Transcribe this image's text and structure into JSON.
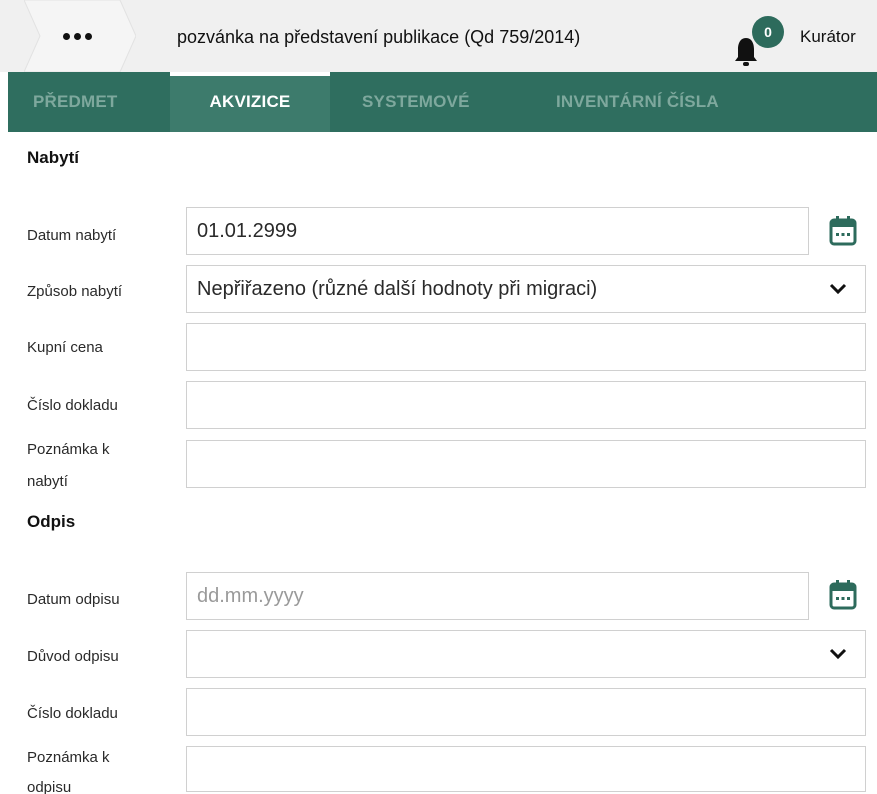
{
  "header": {
    "more_label": "•••",
    "title": "pozvánka na představení publikace (Qd 759/2014)",
    "notification_count": "0",
    "user": "Kurátor"
  },
  "tabs": [
    {
      "label": "PŘEDMET",
      "active": false
    },
    {
      "label": "AKVIZICE",
      "active": true
    },
    {
      "label": "SYSTEMOVÉ",
      "active": false
    },
    {
      "label": "INVENTÁRNÍ ČÍSLA",
      "active": false
    }
  ],
  "acquisition": {
    "title": "Nabytí",
    "date_label": "Datum nabytí",
    "date_value": "01.01.2999",
    "method_label": "Způsob nabytí",
    "method_value": "Nepřiřazeno (různé další hodnoty při migraci)",
    "price_label": "Kupní cena",
    "price_value": "",
    "doc_number_label": "Číslo dokladu",
    "doc_number_value": "",
    "note_label_1": "Poznámka k",
    "note_label_2": "nabytí",
    "note_value": ""
  },
  "writeoff": {
    "title": "Odpis",
    "date_label": "Datum odpisu",
    "date_placeholder": "dd.mm.yyyy",
    "reason_label": "Důvod odpisu",
    "reason_value": "",
    "doc_number_label": "Číslo dokladu",
    "doc_number_value": "",
    "note_label_1": "Poznámka k",
    "note_label_2": "odpisu",
    "note_value": ""
  },
  "colors": {
    "tab_bar": "#2f6e5f",
    "tab_active": "#3d7b6c",
    "badge": "#2d6b5c",
    "calendar_icon": "#2d6b5c"
  }
}
